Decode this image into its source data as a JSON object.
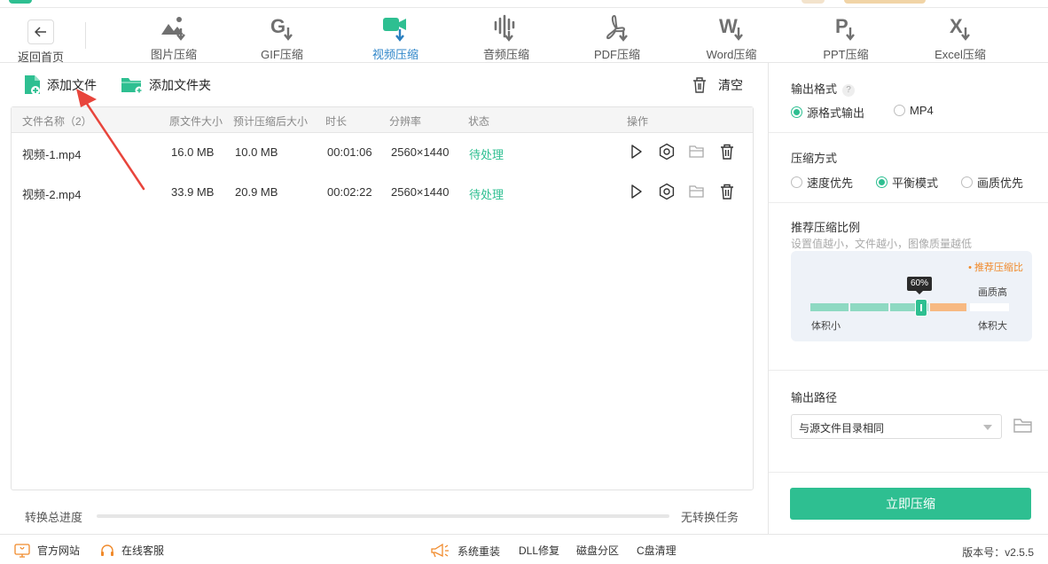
{
  "nav": {
    "back_label": "返回首页",
    "tabs": [
      {
        "label": "图片压缩",
        "icon": "image-compress-icon",
        "active": false
      },
      {
        "label": "GIF压缩",
        "icon": "gif-compress-icon",
        "active": false
      },
      {
        "label": "视频压缩",
        "icon": "video-compress-icon",
        "active": true
      },
      {
        "label": "音频压缩",
        "icon": "audio-compress-icon",
        "active": false
      },
      {
        "label": "PDF压缩",
        "icon": "pdf-compress-icon",
        "active": false
      },
      {
        "label": "Word压缩",
        "icon": "word-compress-icon",
        "active": false
      },
      {
        "label": "PPT压缩",
        "icon": "ppt-compress-icon",
        "active": false
      },
      {
        "label": "Excel压缩",
        "icon": "excel-compress-icon",
        "active": false
      }
    ]
  },
  "toolbar": {
    "add_file": "添加文件",
    "add_folder": "添加文件夹",
    "clear": "清空"
  },
  "table": {
    "headers": {
      "name": "文件名称（2）",
      "orig_size": "原文件大小",
      "est_size": "预计压缩后大小",
      "duration": "时长",
      "resolution": "分辨率",
      "status": "状态",
      "ops": "操作"
    },
    "rows": [
      {
        "name": "视频-1.mp4",
        "orig_size": "16.0 MB",
        "est_size": "10.0 MB",
        "duration": "00:01:06",
        "resolution": "2560×1440",
        "status": "待处理"
      },
      {
        "name": "视频-2.mp4",
        "orig_size": "33.9 MB",
        "est_size": "20.9 MB",
        "duration": "00:02:22",
        "resolution": "2560×1440",
        "status": "待处理"
      }
    ]
  },
  "progress": {
    "label": "转换总进度",
    "value": 0,
    "task_text": "无转换任务"
  },
  "settings": {
    "output_format": {
      "title": "输出格式",
      "help": "?",
      "options": [
        "源格式输出",
        "MP4"
      ],
      "selected": 0
    },
    "compress_mode": {
      "title": "压缩方式",
      "options": [
        "速度优先",
        "平衡模式",
        "画质优先"
      ],
      "selected": 1
    },
    "ratio": {
      "title": "推荐压缩比例",
      "hint": "设置值越小，文件越小，图像质量越低",
      "legend": "• 推荐压缩比",
      "value_label": "60%",
      "value": 60,
      "quality_high": "画质高",
      "size_small": "体积小",
      "size_large": "体积大"
    },
    "output_path": {
      "title": "输出路径",
      "value": "与源文件目录相同"
    },
    "start_button": "立即压缩"
  },
  "footer": {
    "links": [
      "官方网站",
      "在线客服",
      "系统重装",
      "DLL修复",
      "磁盘分区",
      "C盘清理"
    ],
    "version": "版本号：v2.5.5"
  },
  "colors": {
    "accent": "#2ebf91",
    "active_tab": "#2f86c9",
    "recommend": "#f08a2b",
    "arrow": "#e8453c"
  }
}
